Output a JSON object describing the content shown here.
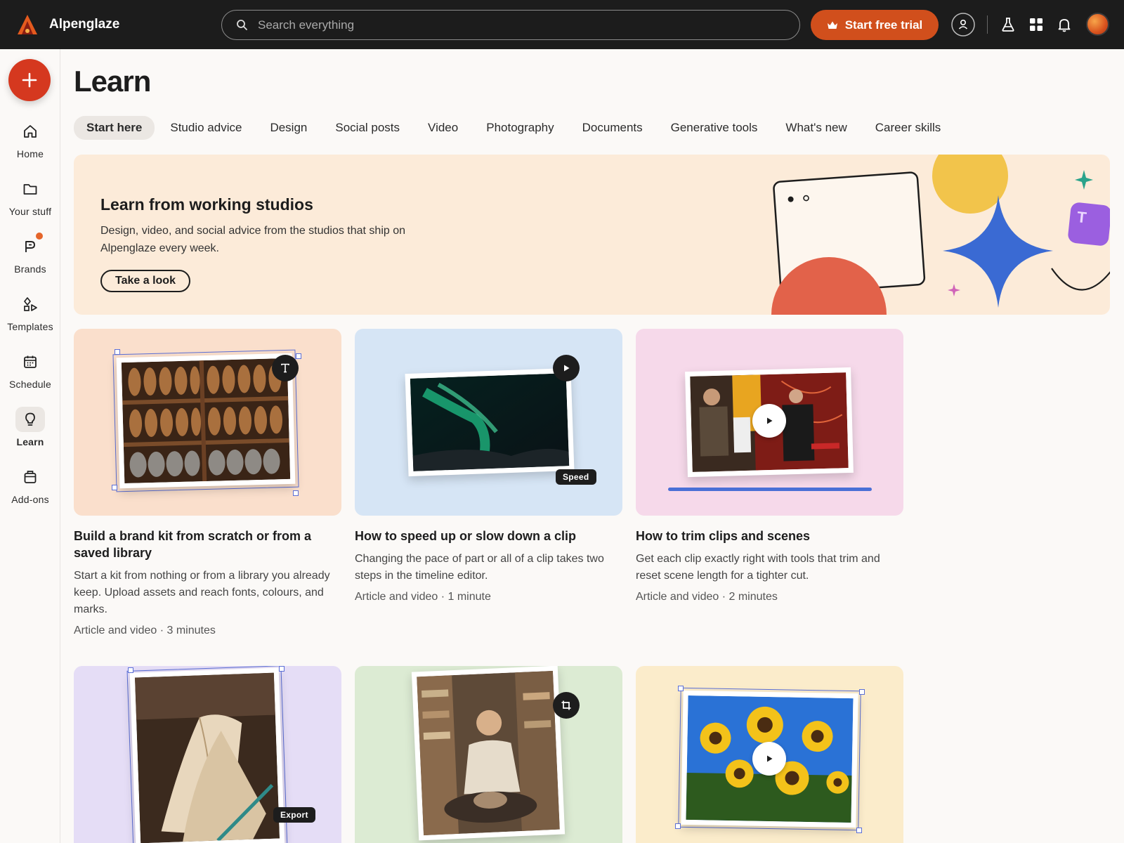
{
  "app": {
    "name": "Alpenglaze"
  },
  "search": {
    "placeholder": "Search everything"
  },
  "topbar": {
    "trial_label": "Start free trial"
  },
  "sidebar": {
    "items": [
      {
        "label": "Home",
        "icon": "home-icon"
      },
      {
        "label": "Your stuff",
        "icon": "folder-icon"
      },
      {
        "label": "Brands",
        "icon": "brand-icon"
      },
      {
        "label": "Templates",
        "icon": "templates-icon"
      },
      {
        "label": "Schedule",
        "icon": "calendar-icon"
      },
      {
        "label": "Learn",
        "icon": "lightbulb-icon",
        "active": true
      },
      {
        "label": "Add-ons",
        "icon": "addons-icon"
      }
    ]
  },
  "page": {
    "title": "Learn"
  },
  "tabs": [
    {
      "label": "Start here",
      "active": true
    },
    {
      "label": "Studio advice"
    },
    {
      "label": "Design"
    },
    {
      "label": "Social posts"
    },
    {
      "label": "Video"
    },
    {
      "label": "Photography"
    },
    {
      "label": "Documents"
    },
    {
      "label": "Generative tools"
    },
    {
      "label": "What's new"
    },
    {
      "label": "Career skills"
    }
  ],
  "hero": {
    "title": "Learn from working studios",
    "description": "Design, video, and social advice from the studios that ship on Alpenglaze every week.",
    "button": "Take a look"
  },
  "cards": [
    {
      "title": "Build a brand kit from scratch or from a saved library",
      "description": "Start a kit from nothing or from a library you already keep. Upload assets and reach fonts, colours, and marks.",
      "meta": "Article and video · 3 minutes",
      "bg": "#fadfcc"
    },
    {
      "title": "How to speed up or slow down a clip",
      "description": "Changing the pace of part or all of a clip takes two steps in the timeline editor.",
      "meta": "Article and video · 1 minute",
      "bg": "#d6e5f5",
      "pill": "Speed"
    },
    {
      "title": "How to trim clips and scenes",
      "description": "Get each clip exactly right with tools that trim and reset scene length for a tighter cut.",
      "meta": "Article and video · 2 minutes",
      "bg": "#f6d9ea"
    },
    {
      "bg": "#e5ddf6",
      "pill": "Export"
    },
    {
      "bg": "#dcebd3"
    },
    {
      "bg": "#fbeccb"
    }
  ],
  "colors": {
    "accent": "#d14f1c",
    "create": "#d5381f",
    "topbar": "#1c1c1c",
    "selection": "#5b6fd6"
  }
}
